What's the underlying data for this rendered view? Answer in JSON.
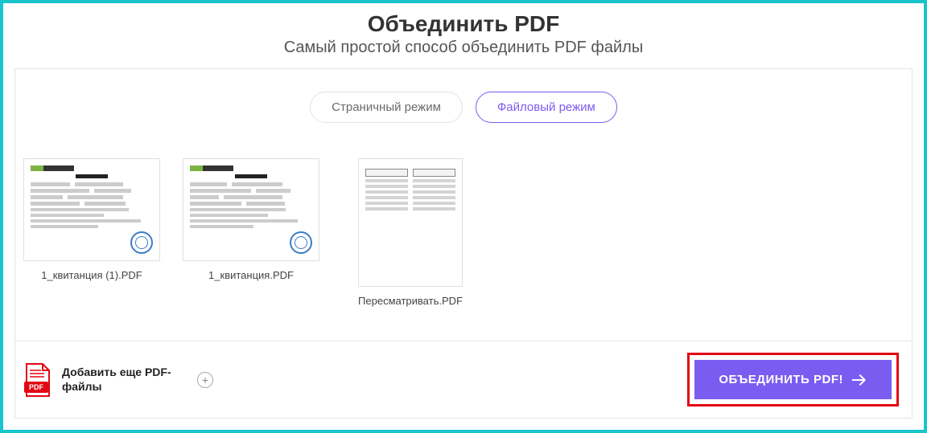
{
  "header": {
    "title": "Объединить PDF",
    "subtitle": "Самый простой способ объединить PDF файлы"
  },
  "modes": {
    "page": "Страничный режим",
    "file": "Файловый режим"
  },
  "files": [
    {
      "name": "1_квитанция (1).PDF",
      "kind": "receipt"
    },
    {
      "name": "1_квитанция.PDF",
      "kind": "receipt"
    },
    {
      "name": "Пересматривать.PDF",
      "kind": "table"
    }
  ],
  "footer": {
    "addLabel": "Добавить еще PDF-файлы",
    "mergeLabel": "ОБЪЕДИНИТЬ PDF!"
  }
}
